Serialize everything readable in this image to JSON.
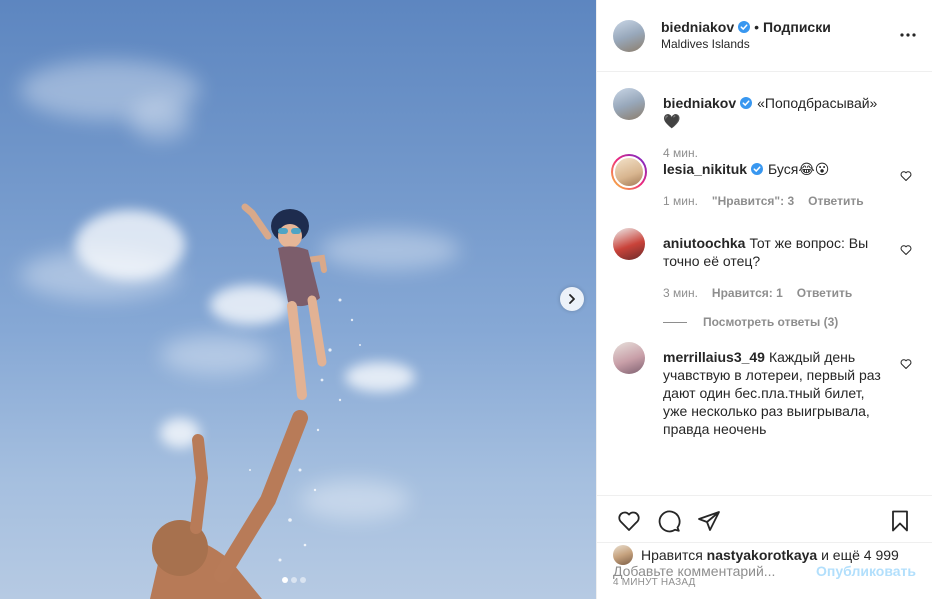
{
  "colors": {
    "link": "#0095f6",
    "publish_disabled": "#b2dffc",
    "muted": "#8e8e8e",
    "text": "#262626",
    "verified": "#3897f0"
  },
  "media": {
    "next_icon": "chevron-right-icon",
    "carousel": {
      "total": 3,
      "active": 1
    }
  },
  "header": {
    "username": "biedniakov",
    "separator": "•",
    "follow_label": "Подписки",
    "location": "Maldives Islands",
    "more_icon": "more-horizontal-icon"
  },
  "caption": {
    "username": "biedniakov",
    "text": "«Поподбрасывай» 🖤",
    "time": "4 мин."
  },
  "comments": [
    {
      "username": "lesia_nikituk",
      "verified": true,
      "text": "Буся😂😮",
      "time": "1 мин.",
      "likes": "\"Нравится\": 3",
      "reply": "Ответить"
    },
    {
      "username": "aniutoochka",
      "verified": false,
      "text": "Тот же вопрос: Вы точно её отец?",
      "time": "3 мин.",
      "likes": "Нравится: 1",
      "reply": "Ответить",
      "view_replies": "Посмотреть ответы (3)"
    },
    {
      "username": "merrillaius3_49",
      "verified": false,
      "text": "Каждый день учавствую в лотереи, первый раз дают один бес.пла.тный билет, уже несколько раз выигрывала, правда неочень"
    }
  ],
  "actions": {
    "like_icon": "heart-icon",
    "comment_icon": "comment-icon",
    "share_icon": "share-icon",
    "save_icon": "bookmark-icon"
  },
  "likes": {
    "prefix": "Нравится",
    "user": "nastyakorotkaya",
    "suffix": "и ещё 4 999"
  },
  "timestamp": "4 МИНУТ НАЗАД",
  "add_comment": {
    "placeholder": "Добавьте комментарий...",
    "publish_label": "Опубликовать"
  }
}
